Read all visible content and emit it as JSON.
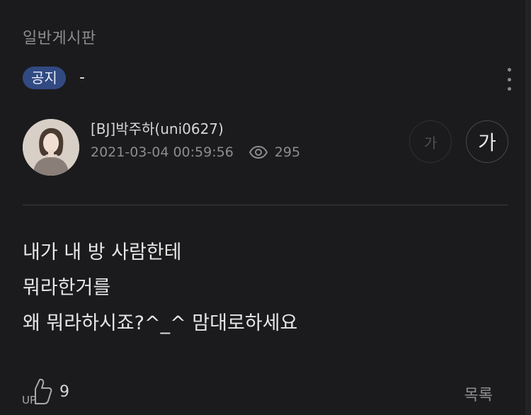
{
  "board": {
    "name": "일반게시판"
  },
  "post": {
    "badge": "공지",
    "title": "-",
    "author": "[BJ]박주하(uni0627)",
    "datetime": "2021-03-04 00:59:56",
    "views": "295",
    "content_lines": [
      "내가 내 방 사람한테",
      "뭐라한거를",
      "왜 뭐라하시죠?^_^ 맘대로하세요"
    ]
  },
  "font_controls": {
    "small_label": "가",
    "large_label": "가"
  },
  "footer": {
    "up_label": "UP",
    "likes": "9",
    "list_label": "목록"
  },
  "icons": {
    "more": "more-vertical-icon",
    "views": "eye-icon",
    "like": "thumbs-up-icon"
  },
  "colors": {
    "background": "#1b1b1d",
    "badge": "#324a82",
    "divider": "#3a3a3d"
  }
}
